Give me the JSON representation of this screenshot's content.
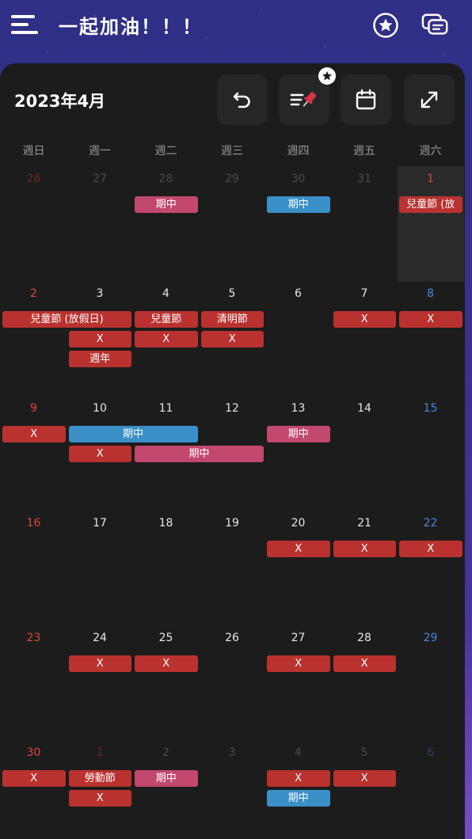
{
  "app": {
    "title": "一起加油！！！",
    "menu_icon": "menu-icon",
    "star_icon": "star-circle-icon",
    "chat_icon": "chat-bubbles-icon"
  },
  "calendar": {
    "month_title": "2023年4月",
    "toolbar": [
      "undo-icon",
      "pin-list-icon",
      "calendar-icon",
      "expand-icon"
    ],
    "weekdays": [
      "週日",
      "週一",
      "週二",
      "週三",
      "週四",
      "週五",
      "週六"
    ],
    "weeks": [
      [
        "26",
        "27",
        "28",
        "29",
        "30",
        "31",
        "1"
      ],
      [
        "2",
        "3",
        "4",
        "5",
        "6",
        "7",
        "8"
      ],
      [
        "9",
        "10",
        "11",
        "12",
        "13",
        "14",
        "15"
      ],
      [
        "16",
        "17",
        "18",
        "19",
        "20",
        "21",
        "22"
      ],
      [
        "23",
        "24",
        "25",
        "26",
        "27",
        "28",
        "29"
      ],
      [
        "30",
        "1",
        "2",
        "3",
        "4",
        "5",
        "6"
      ]
    ],
    "events": [
      {
        "week": 0,
        "col": 2,
        "span": 1,
        "slot": 0,
        "text": "期中",
        "color": "pink"
      },
      {
        "week": 0,
        "col": 4,
        "span": 1,
        "slot": 0,
        "text": "期中",
        "color": "blue"
      },
      {
        "week": 0,
        "col": 6,
        "span": 1,
        "slot": 0,
        "text": "兒童節 (放",
        "color": "red"
      },
      {
        "week": 1,
        "col": 0,
        "span": 2,
        "slot": 0,
        "text": "兒童節 (放假日)",
        "color": "red"
      },
      {
        "week": 1,
        "col": 2,
        "span": 1,
        "slot": 0,
        "text": "兒童節",
        "color": "red"
      },
      {
        "week": 1,
        "col": 3,
        "span": 1,
        "slot": 0,
        "text": "清明節",
        "color": "red"
      },
      {
        "week": 1,
        "col": 5,
        "span": 1,
        "slot": 0,
        "text": "X",
        "color": "red"
      },
      {
        "week": 1,
        "col": 6,
        "span": 1,
        "slot": 0,
        "text": "X",
        "color": "red"
      },
      {
        "week": 1,
        "col": 1,
        "span": 1,
        "slot": 1,
        "text": "X",
        "color": "red"
      },
      {
        "week": 1,
        "col": 2,
        "span": 1,
        "slot": 1,
        "text": "X",
        "color": "red"
      },
      {
        "week": 1,
        "col": 3,
        "span": 1,
        "slot": 1,
        "text": "X",
        "color": "red"
      },
      {
        "week": 1,
        "col": 1,
        "span": 1,
        "slot": 2,
        "text": "週年",
        "color": "red"
      },
      {
        "week": 2,
        "col": 0,
        "span": 1,
        "slot": 0,
        "text": "X",
        "color": "red"
      },
      {
        "week": 2,
        "col": 1,
        "span": 2,
        "slot": 0,
        "text": "期中",
        "color": "blue"
      },
      {
        "week": 2,
        "col": 4,
        "span": 1,
        "slot": 0,
        "text": "期中",
        "color": "pink"
      },
      {
        "week": 2,
        "col": 1,
        "span": 1,
        "slot": 1,
        "text": "X",
        "color": "red"
      },
      {
        "week": 2,
        "col": 2,
        "span": 2,
        "slot": 1,
        "text": "期中",
        "color": "pink"
      },
      {
        "week": 3,
        "col": 4,
        "span": 1,
        "slot": 0,
        "text": "X",
        "color": "red"
      },
      {
        "week": 3,
        "col": 5,
        "span": 1,
        "slot": 0,
        "text": "X",
        "color": "red"
      },
      {
        "week": 3,
        "col": 6,
        "span": 1,
        "slot": 0,
        "text": "X",
        "color": "red"
      },
      {
        "week": 4,
        "col": 1,
        "span": 1,
        "slot": 0,
        "text": "X",
        "color": "red"
      },
      {
        "week": 4,
        "col": 2,
        "span": 1,
        "slot": 0,
        "text": "X",
        "color": "red"
      },
      {
        "week": 4,
        "col": 4,
        "span": 1,
        "slot": 0,
        "text": "X",
        "color": "red"
      },
      {
        "week": 4,
        "col": 5,
        "span": 1,
        "slot": 0,
        "text": "X",
        "color": "red"
      },
      {
        "week": 5,
        "col": 0,
        "span": 1,
        "slot": 0,
        "text": "X",
        "color": "red"
      },
      {
        "week": 5,
        "col": 1,
        "span": 1,
        "slot": 0,
        "text": "勞動節",
        "color": "red"
      },
      {
        "week": 5,
        "col": 2,
        "span": 1,
        "slot": 0,
        "text": "期中",
        "color": "pink"
      },
      {
        "week": 5,
        "col": 4,
        "span": 1,
        "slot": 0,
        "text": "X",
        "color": "red"
      },
      {
        "week": 5,
        "col": 5,
        "span": 1,
        "slot": 0,
        "text": "X",
        "color": "red"
      },
      {
        "week": 5,
        "col": 1,
        "span": 1,
        "slot": 1,
        "text": "X",
        "color": "red"
      },
      {
        "week": 5,
        "col": 4,
        "span": 1,
        "slot": 1,
        "text": "期中",
        "color": "blue"
      }
    ],
    "colors": {
      "red": "#b9322f",
      "pink": "#c2486e",
      "blue": "#3a8fc6",
      "sunday": "#e2443f",
      "saturday": "#4a86e8",
      "weekday": "#e6e6e6",
      "other_month": "#4a4a4a",
      "other_month_sunday": "#6b2a28",
      "other_month_saturday": "#2d3f66"
    }
  }
}
